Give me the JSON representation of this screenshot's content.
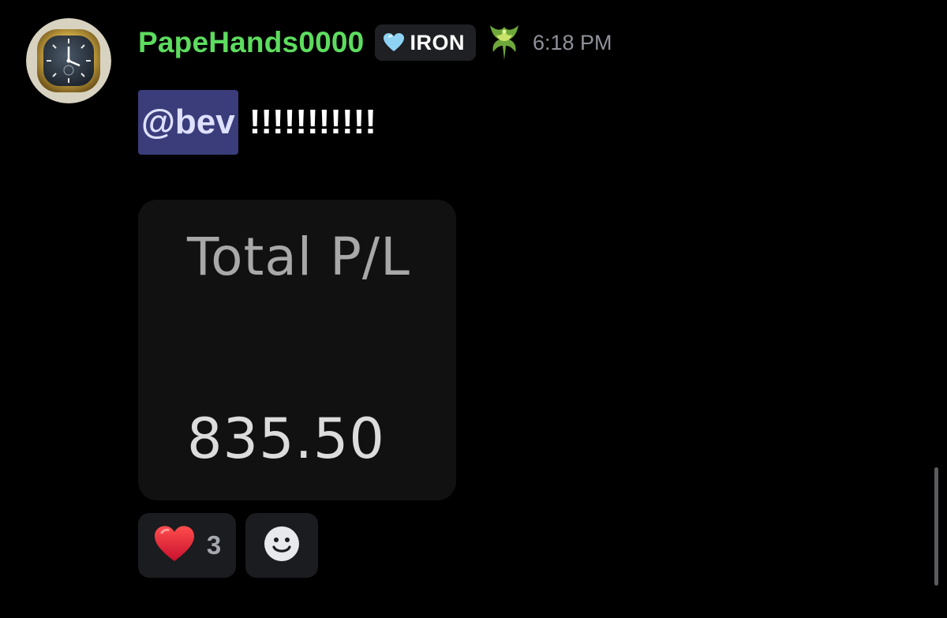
{
  "message": {
    "author": {
      "username": "PapeHands0000",
      "username_color": "#5ddc5f",
      "avatar": "watch-avatar",
      "role_tag": {
        "icon": "heart-icon",
        "label": "IRON",
        "icon_color": "#8fd3f4"
      },
      "guild_icon": "phoenix-icon"
    },
    "timestamp": "6:18 PM",
    "mention": "@bev",
    "text": "!!!!!!!!!!!",
    "attachment": {
      "label": "Total P/L",
      "value": "835.50"
    },
    "reactions": [
      {
        "emoji": "heart-emoji",
        "count": "3"
      }
    ],
    "add_reaction_icon": "smiley-icon"
  }
}
